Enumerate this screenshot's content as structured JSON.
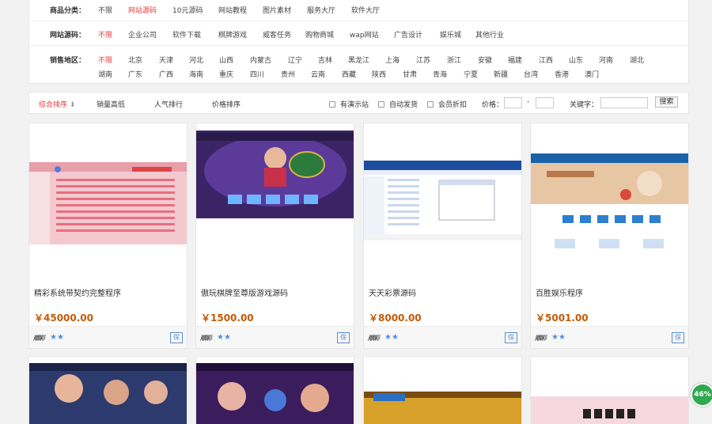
{
  "filters": {
    "category": {
      "label": "商品分类：",
      "options": [
        "不限",
        "网站源码",
        "10元源码",
        "网站教程",
        "图片素材",
        "服务大厅",
        "软件大厅"
      ],
      "active": 1
    },
    "source": {
      "label": "网站源码：",
      "options": [
        "不限",
        "企业公司",
        "软件下载",
        "棋牌游戏",
        "威客任务",
        "购物商城",
        "wap网站",
        "广告设计",
        "娱乐城",
        "其他行业"
      ],
      "active": 0
    },
    "region": {
      "label": "销售地区：",
      "row1": [
        "不限",
        "北京",
        "天津",
        "河北",
        "山西",
        "内蒙古",
        "辽宁",
        "吉林",
        "黑龙江",
        "上海",
        "江苏",
        "浙江",
        "安徽",
        "福建",
        "江西",
        "山东",
        "河南",
        "湖北"
      ],
      "row2": [
        "湖南",
        "广东",
        "广西",
        "海南",
        "重庆",
        "四川",
        "贵州",
        "云南",
        "西藏",
        "陕西",
        "甘肃",
        "青海",
        "宁夏",
        "新疆",
        "台湾",
        "香港",
        "澳门"
      ],
      "active": 0
    }
  },
  "sortbar": {
    "sorts": [
      "综合排序",
      "销量高低",
      "人气排行",
      "价格排序"
    ],
    "active_arrow": "⬇",
    "checks": [
      "有演示站",
      "自动发货",
      "会员折扣"
    ],
    "price_label": "价格：",
    "dash": "-",
    "keyword_label": "关键字：",
    "search_button": "搜索"
  },
  "products": [
    {
      "title": "精彩系统带契约完整程序",
      "price": "￥45000.00"
    },
    {
      "title": "傲玩棋牌至尊版游戏源码",
      "price": "￥1500.00"
    },
    {
      "title": "天天彩票源码",
      "price": "￥8000.00"
    },
    {
      "title": "百胜娱乐程序",
      "price": "￥5001.00"
    }
  ],
  "card_footer": {
    "logo": "顺彩",
    "stars": "★★",
    "guarantee": "保"
  },
  "badge": "46%",
  "colors": {
    "accent": "#e4393c",
    "price": "#c25a06",
    "star": "#5a8dd6",
    "badge": "#2fa84f"
  }
}
